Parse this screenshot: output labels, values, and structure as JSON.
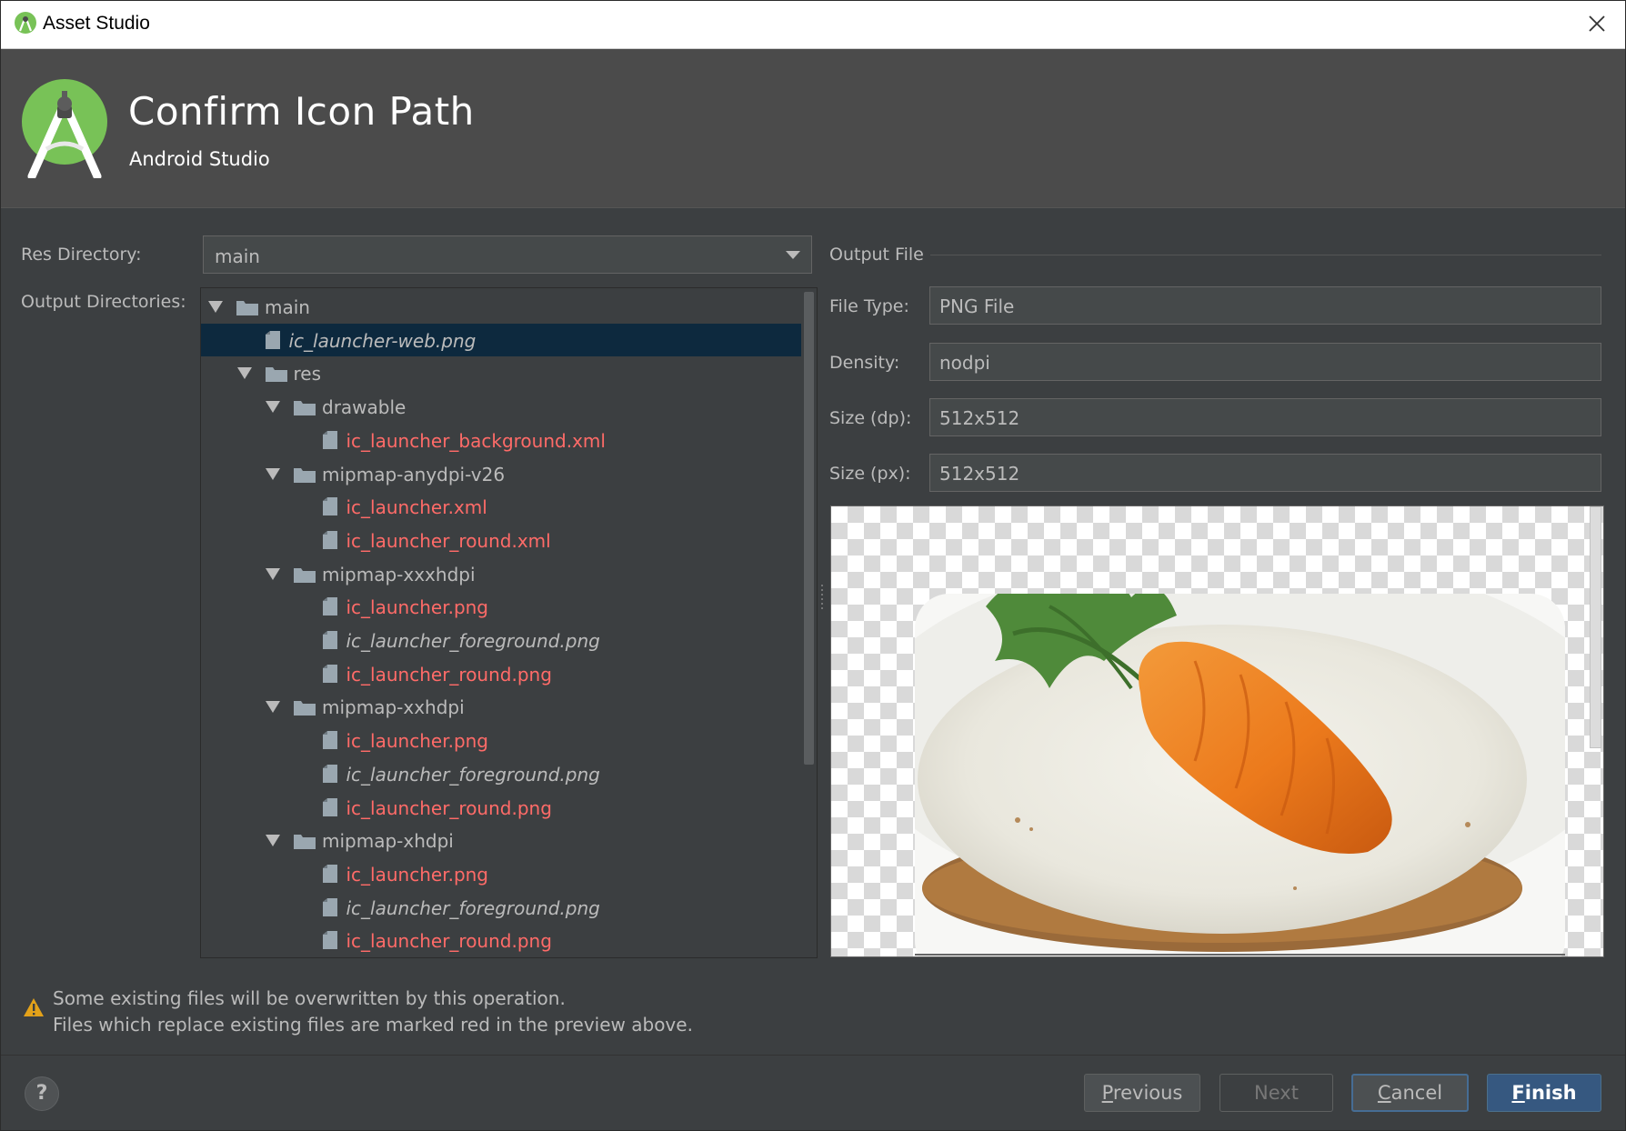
{
  "window": {
    "title": "Asset Studio"
  },
  "header": {
    "title": "Confirm Icon Path",
    "subtitle": "Android Studio"
  },
  "form": {
    "res_directory_label": "Res Directory:",
    "res_directory_value": "main",
    "output_directories_label": "Output Directories:"
  },
  "tree": {
    "rows": [
      {
        "name": "main",
        "kind": "folder",
        "level": 0,
        "expanded": true,
        "style": "normal"
      },
      {
        "name": "ic_launcher-web.png",
        "kind": "file",
        "level": 1,
        "style": "italic",
        "selected": true
      },
      {
        "name": "res",
        "kind": "folder",
        "level": 1,
        "expanded": true,
        "style": "normal"
      },
      {
        "name": "drawable",
        "kind": "folder",
        "level": 2,
        "expanded": true,
        "style": "normal"
      },
      {
        "name": "ic_launcher_background.xml",
        "kind": "file",
        "level": 3,
        "style": "red"
      },
      {
        "name": "mipmap-anydpi-v26",
        "kind": "folder",
        "level": 2,
        "expanded": true,
        "style": "normal"
      },
      {
        "name": "ic_launcher.xml",
        "kind": "file",
        "level": 3,
        "style": "red"
      },
      {
        "name": "ic_launcher_round.xml",
        "kind": "file",
        "level": 3,
        "style": "red"
      },
      {
        "name": "mipmap-xxxhdpi",
        "kind": "folder",
        "level": 2,
        "expanded": true,
        "style": "normal"
      },
      {
        "name": "ic_launcher.png",
        "kind": "file",
        "level": 3,
        "style": "red"
      },
      {
        "name": "ic_launcher_foreground.png",
        "kind": "file",
        "level": 3,
        "style": "italic"
      },
      {
        "name": "ic_launcher_round.png",
        "kind": "file",
        "level": 3,
        "style": "red"
      },
      {
        "name": "mipmap-xxhdpi",
        "kind": "folder",
        "level": 2,
        "expanded": true,
        "style": "normal"
      },
      {
        "name": "ic_launcher.png",
        "kind": "file",
        "level": 3,
        "style": "red"
      },
      {
        "name": "ic_launcher_foreground.png",
        "kind": "file",
        "level": 3,
        "style": "italic"
      },
      {
        "name": "ic_launcher_round.png",
        "kind": "file",
        "level": 3,
        "style": "red"
      },
      {
        "name": "mipmap-xhdpi",
        "kind": "folder",
        "level": 2,
        "expanded": true,
        "style": "normal"
      },
      {
        "name": "ic_launcher.png",
        "kind": "file",
        "level": 3,
        "style": "red"
      },
      {
        "name": "ic_launcher_foreground.png",
        "kind": "file",
        "level": 3,
        "style": "italic"
      },
      {
        "name": "ic_launcher_round.png",
        "kind": "file",
        "level": 3,
        "style": "red"
      }
    ]
  },
  "output_file": {
    "section_title": "Output File",
    "file_type_label": "File Type:",
    "file_type_value": "PNG File",
    "density_label": "Density:",
    "density_value": "nodpi",
    "size_dp_label": "Size (dp):",
    "size_dp_value": "512x512",
    "size_px_label": "Size (px):",
    "size_px_value": "512x512"
  },
  "warning": {
    "line1": "Some existing files will be overwritten by this operation.",
    "line2": "Files which replace existing files are marked red in the preview above."
  },
  "buttons": {
    "help": "?",
    "previous_mnemonic": "P",
    "previous_rest": "revious",
    "next": "Next",
    "cancel_mnemonic": "C",
    "cancel_rest": "ancel",
    "finish_mnemonic": "F",
    "finish_rest": "inish"
  },
  "colors": {
    "background": "#3c3f41",
    "header": "#4b4b4b",
    "overwritten_file": "#ff6b68",
    "selection": "#0d293e",
    "default_button": "#365880",
    "android_green": "#78c257"
  },
  "icons": {
    "app": "android-studio-icon",
    "close": "close-icon",
    "folder": "folder-icon",
    "file": "file-icon",
    "warning": "warning-icon",
    "help": "help-icon",
    "combo_arrow": "chevron-down-icon"
  }
}
